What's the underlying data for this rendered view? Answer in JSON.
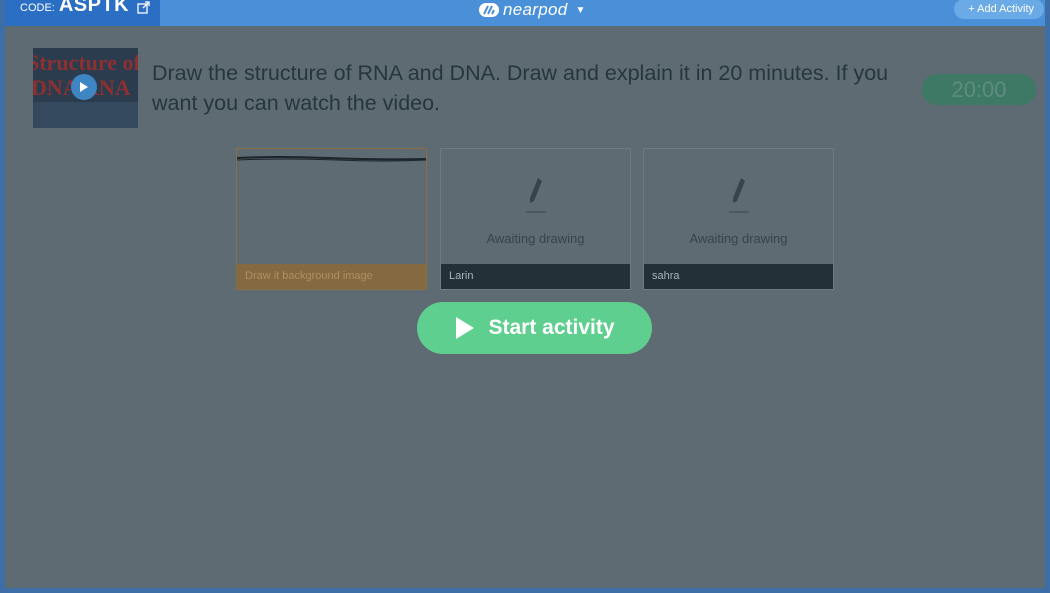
{
  "topbar": {
    "code_label": "CODE:",
    "code_value": "ASPTK",
    "brand": "nearpod",
    "add_activity": "+ Add Activity"
  },
  "video": {
    "thumb_line1": "Structure of",
    "thumb_line2": "DNA  RNA"
  },
  "activity": {
    "prompt": "Draw the structure of RNA and DNA. Draw and explain it in 20 minutes. If you want you can watch the video.",
    "timer": "20:00"
  },
  "cards": [
    {
      "caption": "Draw it background image",
      "status": ""
    },
    {
      "caption": "Larin",
      "status": "Awaiting drawing"
    },
    {
      "caption": "sahra",
      "status": "Awaiting drawing"
    }
  ],
  "start_button": {
    "label": "Start activity"
  },
  "colors": {
    "topbar": "#4a90d9",
    "code_box": "#2a6fc4",
    "overlay": "#5e6b72",
    "timer": "#3d7965",
    "start_button": "#5ecf8f",
    "selected_card": "#846941"
  },
  "icons": {
    "share": "share-icon",
    "brand": "nearpod-logo-icon",
    "caret": "chevron-down-icon",
    "play": "play-icon",
    "pencil": "pencil-icon"
  }
}
